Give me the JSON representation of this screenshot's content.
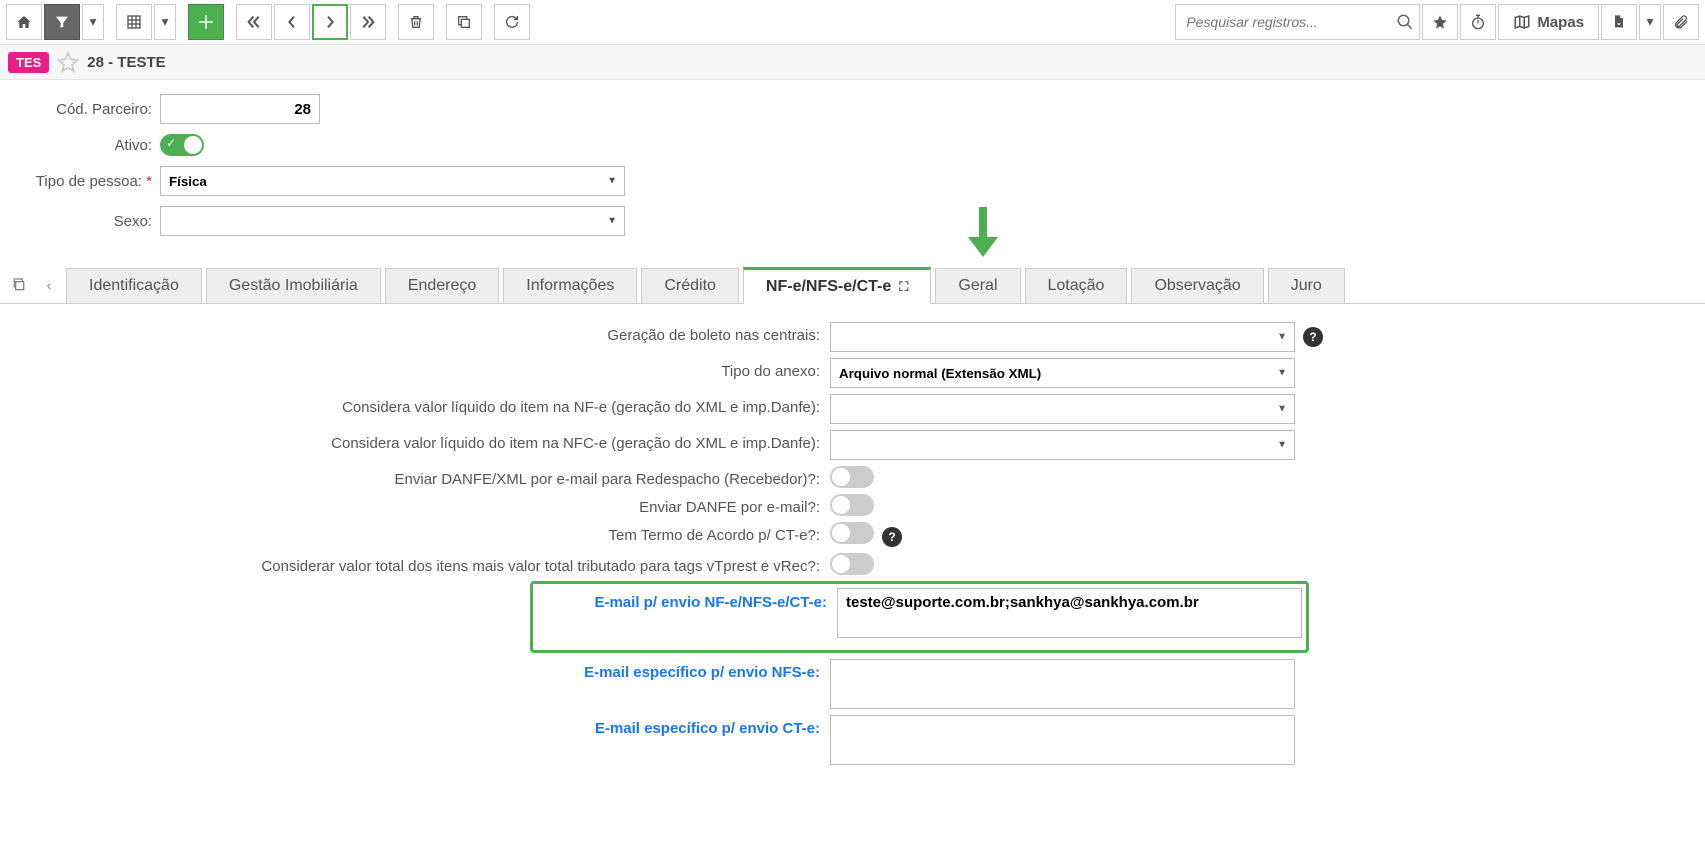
{
  "toolbar": {
    "search_placeholder": "Pesquisar registros...",
    "maps_label": "Mapas"
  },
  "headline": {
    "badge": "TES",
    "title": "28 - TESTE"
  },
  "form": {
    "cod_parceiro_label": "Cód. Parceiro:",
    "cod_parceiro_value": "28",
    "ativo_label": "Ativo:",
    "tipo_pessoa_label": "Tipo de pessoa:",
    "tipo_pessoa_value": "Física",
    "sexo_label": "Sexo:",
    "sexo_value": ""
  },
  "tabs": [
    {
      "label": "Identificação"
    },
    {
      "label": "Gestão Imobiliária"
    },
    {
      "label": "Endereço"
    },
    {
      "label": "Informações"
    },
    {
      "label": "Crédito"
    },
    {
      "label": "NF-e/NFS-e/CT-e"
    },
    {
      "label": "Geral"
    },
    {
      "label": "Lotação"
    },
    {
      "label": "Observação"
    },
    {
      "label": "Juro"
    }
  ],
  "details": {
    "geracao_boleto_label": "Geração de boleto nas centrais:",
    "geracao_boleto_value": "",
    "tipo_anexo_label": "Tipo do anexo:",
    "tipo_anexo_value": "Arquivo normal (Extensão XML)",
    "considera_nfe_label": "Considera valor líquido do item na NF-e (geração do XML e imp.Danfe):",
    "considera_nfe_value": "",
    "considera_nfce_label": "Considera valor líquido do item na NFC-e (geração do XML e imp.Danfe):",
    "considera_nfce_value": "",
    "enviar_danfe_redespacho_label": "Enviar DANFE/XML por e-mail para Redespacho (Recebedor)?:",
    "enviar_danfe_email_label": "Enviar DANFE por e-mail?:",
    "termo_acordo_label": "Tem Termo de Acordo p/ CT-e?:",
    "considerar_total_label": "Considerar valor total dos itens mais valor total tributado para tags vTprest e vRec?:",
    "email_envio_label": "E-mail p/ envio NF-e/NFS-e/CT-e:",
    "email_envio_value": "teste@suporte.com.br;sankhya@sankhya.com.br",
    "email_nfse_label": "E-mail específico p/ envio NFS-e:",
    "email_nfse_value": "",
    "email_cte_label": "E-mail específico p/ envio CT-e:",
    "email_cte_value": ""
  }
}
